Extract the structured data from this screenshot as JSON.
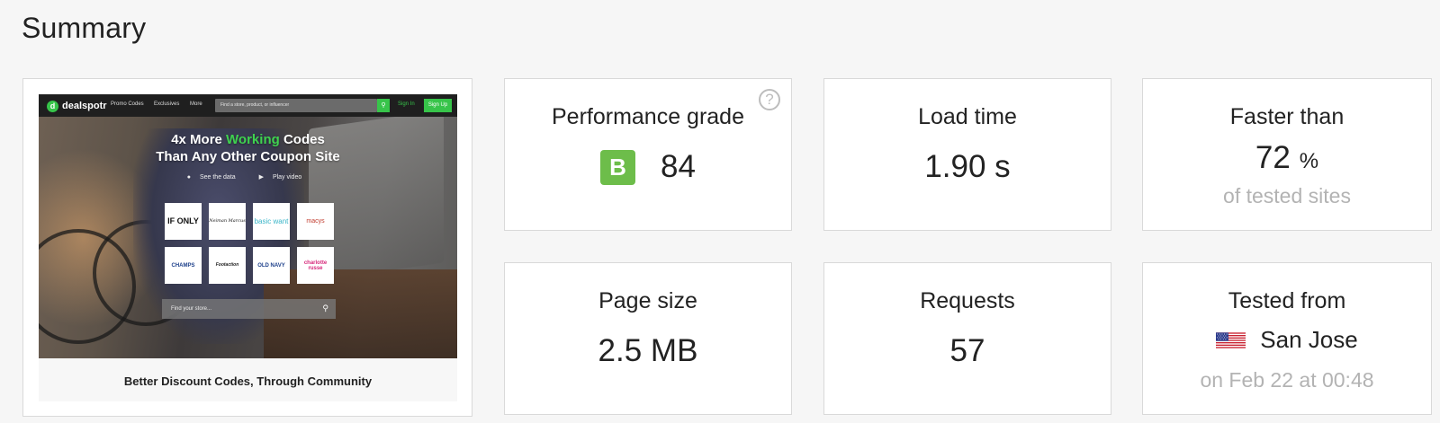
{
  "page": {
    "title": "Summary"
  },
  "screenshot": {
    "nav": {
      "logo": "dealspotr",
      "links": [
        "Promo Codes",
        "Exclusives",
        "More"
      ],
      "search_placeholder": "Find a store, product, or influencer",
      "signin": "Sign In",
      "signup": "Sign Up"
    },
    "hero": {
      "line1_prefix": "4x More ",
      "line1_highlight": "Working",
      "line1_suffix": " Codes",
      "line2": "Than Any Other Coupon Site",
      "actions": [
        "See the data",
        "Play video"
      ]
    },
    "brands": [
      "IF ONLY",
      "Neiman Marcus",
      "basic want",
      "macys",
      "CHAMPS",
      "Footaction",
      "OLD NAVY",
      "charlotte russe"
    ],
    "search_placeholder": "Find your store...",
    "caption": "Better Discount Codes, Through Community",
    "accent_color": "#37c44a"
  },
  "metrics": {
    "performance": {
      "label": "Performance grade",
      "grade": "B",
      "score": "84",
      "grade_color": "#6dbd4a"
    },
    "load_time": {
      "label": "Load time",
      "value": "1.90 s"
    },
    "faster_than": {
      "label": "Faster than",
      "value": "72",
      "unit": "%",
      "sub": "of tested sites"
    },
    "page_size": {
      "label": "Page size",
      "value": "2.5 MB"
    },
    "requests": {
      "label": "Requests",
      "value": "57"
    },
    "tested_from": {
      "label": "Tested from",
      "location": "San Jose",
      "flag": "us-flag-icon",
      "sub": "on Feb 22 at 00:48"
    }
  }
}
